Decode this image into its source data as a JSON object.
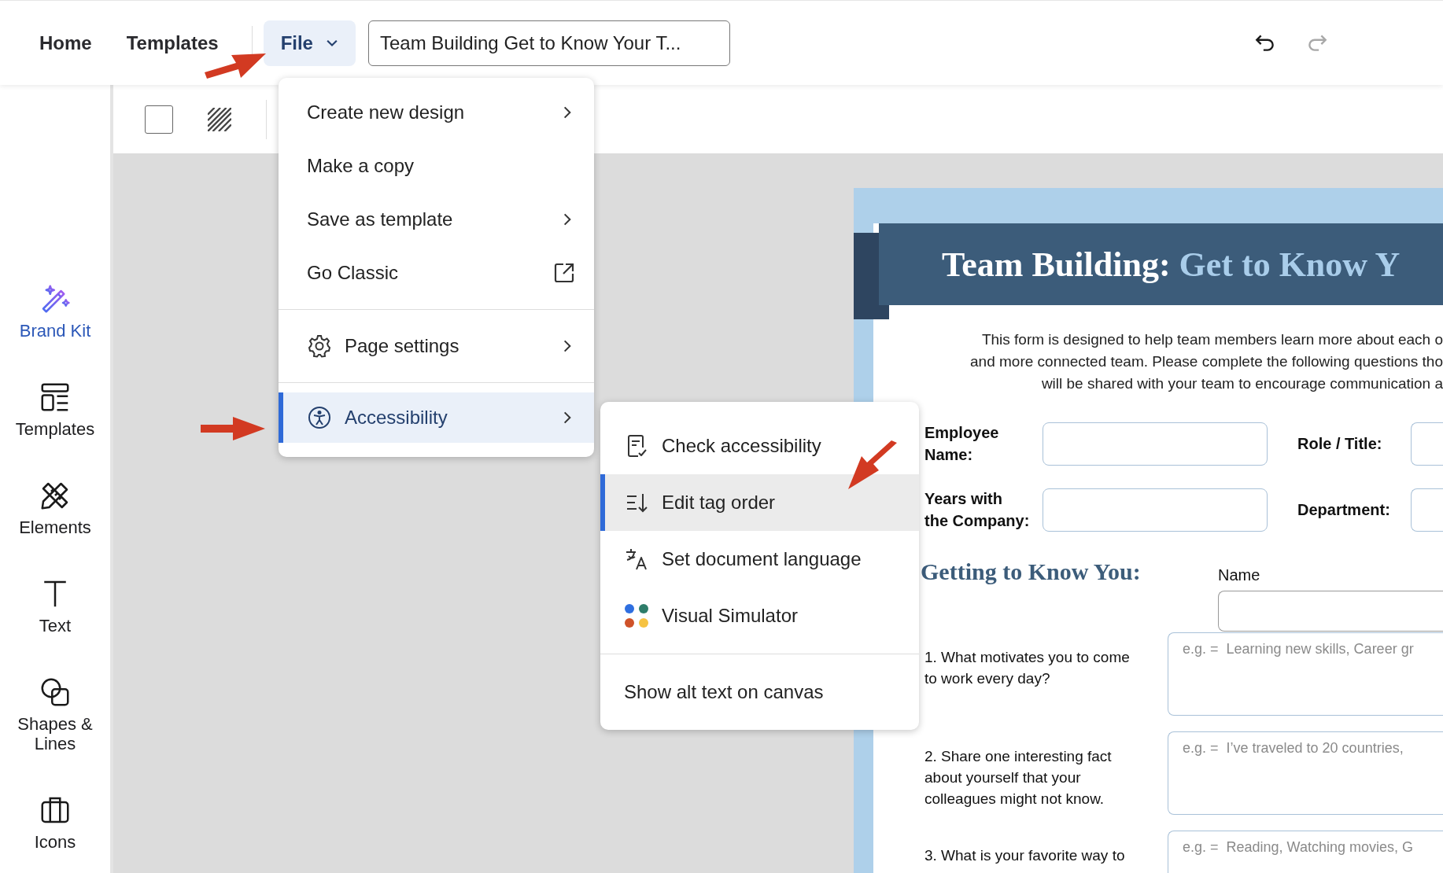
{
  "top_bar": {
    "nav_links": [
      {
        "label": "Home"
      },
      {
        "label": "Templates"
      }
    ],
    "file_button": {
      "label": "File",
      "expanded": true
    },
    "document_title": {
      "value": "Team Building Get to Know Your T..."
    },
    "history": [
      {
        "kind": "undo",
        "disabled": false
      },
      {
        "kind": "redo",
        "disabled": true
      }
    ]
  },
  "sidebar": {
    "items": [
      {
        "label": "Brand Kit",
        "selected": true
      },
      {
        "label": "Templates",
        "selected": false
      },
      {
        "label": "Elements",
        "selected": false
      },
      {
        "label": "Text",
        "selected": false
      },
      {
        "label": "Shapes & Lines",
        "selected": false
      },
      {
        "label": "Icons",
        "selected": false
      }
    ]
  },
  "file_menu": {
    "sections": [
      [
        {
          "label": "Create new design",
          "kind": "submenu",
          "selected": false
        },
        {
          "label": "Make a copy",
          "kind": "plain",
          "selected": false
        },
        {
          "label": "Save as template",
          "kind": "submenu",
          "selected": false
        },
        {
          "label": "Go Classic",
          "kind": "external",
          "selected": false
        }
      ],
      [
        {
          "label": "Page settings",
          "kind": "submenu",
          "selected": false
        }
      ],
      [
        {
          "label": "Accessibility",
          "kind": "submenu",
          "selected": true
        }
      ]
    ]
  },
  "accessibility_menu": {
    "sections": [
      [
        {
          "label": "Check accessibility",
          "selected": false
        },
        {
          "label": "Edit tag order",
          "selected": true
        },
        {
          "label": "Set document language",
          "selected": false
        },
        {
          "label": "Visual Simulator",
          "selected": false
        }
      ],
      [
        {
          "label": "Show alt text on canvas",
          "selected": false
        }
      ]
    ]
  },
  "document": {
    "title": "Team Building:",
    "title_accent": "Get to Know Y",
    "intro_lines": [
      "This form is designed to help team members learn more about each o",
      "and more connected team. Please complete the following questions tho",
      "will be shared with your team to encourage communication a"
    ],
    "fields": [
      {
        "label": "Employee Name:"
      },
      {
        "label": "Role / Title:"
      },
      {
        "label": "Years with the Company:"
      },
      {
        "label": "Department:"
      }
    ],
    "section_heading": "Getting to Know You:",
    "name_field": {
      "label": "Name"
    },
    "questions": [
      {
        "text": "1. What motivates you to come to work every day?",
        "placeholder": "e.g. =  Learning new skills, Career gr"
      },
      {
        "text": "2. Share one interesting fact about yourself that your colleagues might not know.",
        "placeholder": "e.g. =  I’ve traveled to 20 countries,"
      },
      {
        "text": "3. What is your favorite way to",
        "placeholder": "e.g. =  Reading, Watching movies, G"
      }
    ]
  }
}
